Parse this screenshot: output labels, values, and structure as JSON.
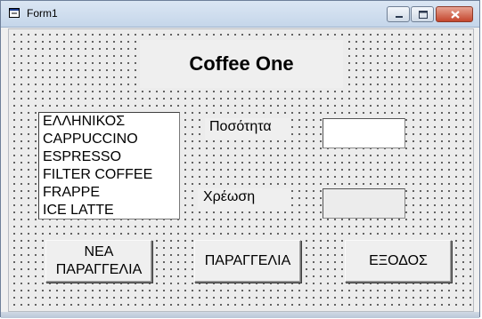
{
  "window": {
    "title": "Form1",
    "icon": "form-icon",
    "controls": [
      "minimize-icon",
      "maximize-icon",
      "close-icon"
    ]
  },
  "form": {
    "heading": "Coffee One",
    "coffee_list": [
      "ΕΛΛΗΝΙΚΟΣ",
      "CAPPUCCINO",
      "ESPRESSO",
      "FILTER COFFEE",
      "FRAPPE",
      "ICE LATTE"
    ],
    "quantity_label": "Ποσότητα",
    "quantity_value": "",
    "charge_label": "Χρέωση",
    "charge_value": "",
    "new_order_label_line1": "ΝΕΑ",
    "new_order_label_line2": "ΠΑΡΑΓΓΕΛΙΑ",
    "order_label": "ΠΑΡΑΓΓΕΛΙΑ",
    "exit_label": "ΕΞΟΔΟΣ"
  },
  "colors": {
    "titlebar": "#c5d6ea",
    "form_background": "#ececec",
    "close_button": "#c4462d"
  }
}
